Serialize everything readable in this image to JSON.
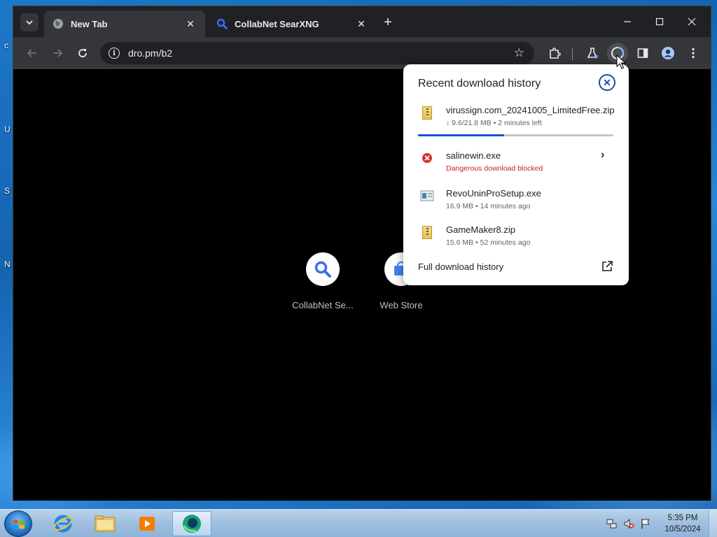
{
  "browser": {
    "tabs": [
      {
        "title": "New Tab",
        "active": true,
        "favicon": "globe-icon"
      },
      {
        "title": "CollabNet SearXNG",
        "active": false,
        "favicon": "search-icon"
      }
    ],
    "url": "dro.pm/b2"
  },
  "new_tab_page": {
    "shortcuts": [
      {
        "label": "CollabNet Se...",
        "icon": "search-icon"
      },
      {
        "label": "Web Store",
        "icon": "web-store-icon"
      }
    ]
  },
  "download_panel": {
    "title": "Recent download history",
    "items": [
      {
        "name": "virussign.com_20241005_LimitedFree.zip",
        "meta": "↓ 9.6/21.8 MB • 2 minutes left",
        "icon": "zip-file-icon",
        "progress": 0.44
      },
      {
        "name": "salinewin.exe",
        "meta": "Dangerous download blocked",
        "icon": "danger-icon",
        "status": "blocked"
      },
      {
        "name": "RevoUninProSetup.exe",
        "meta": "16.9 MB • 14 minutes ago",
        "icon": "exe-file-icon"
      },
      {
        "name": "GameMaker8.zip",
        "meta": "15.6 MB • 52 minutes ago",
        "icon": "zip-file-icon"
      }
    ],
    "footer": "Full download history"
  },
  "taskbar": {
    "time": "5:35 PM",
    "date": "10/5/2024",
    "apps": [
      "internet-explorer-icon",
      "file-explorer-icon",
      "media-player-icon",
      "edge-icon"
    ]
  },
  "desktop": {
    "side_letters": [
      "c",
      "U",
      "S",
      "N"
    ]
  },
  "colors": {
    "accent": "#0b57d0",
    "danger": "#c5221f",
    "chrome_dark": "#202124",
    "toolbar": "#35363a"
  }
}
